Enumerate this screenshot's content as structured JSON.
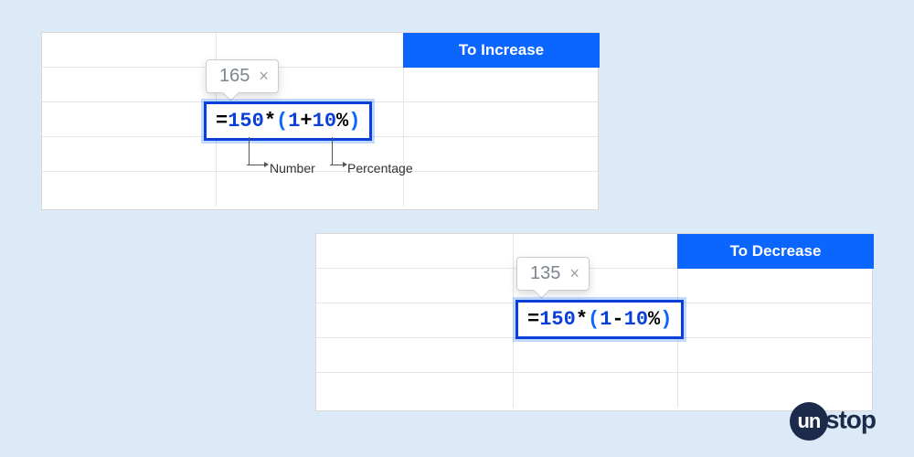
{
  "sheet1": {
    "header": "To Increase"
  },
  "sheet2": {
    "header": "To Decrease"
  },
  "tooltip1": {
    "value": "165"
  },
  "tooltip2": {
    "value": "135"
  },
  "formula1": {
    "eq": "=",
    "n1": "150",
    "mul": "*",
    "open": "(",
    "one": "1",
    "op": "+",
    "pct": "10",
    "pctSym": "%",
    "close": ")"
  },
  "formula2": {
    "eq": "=",
    "n1": "150",
    "mul": "*",
    "open": "(",
    "one": "1",
    "op": "-",
    "pct": "10",
    "pctSym": "%",
    "close": ")"
  },
  "annot": {
    "number": "Number",
    "percentage": "Percentage"
  },
  "logo": {
    "un": "un",
    "rest": "stop"
  }
}
